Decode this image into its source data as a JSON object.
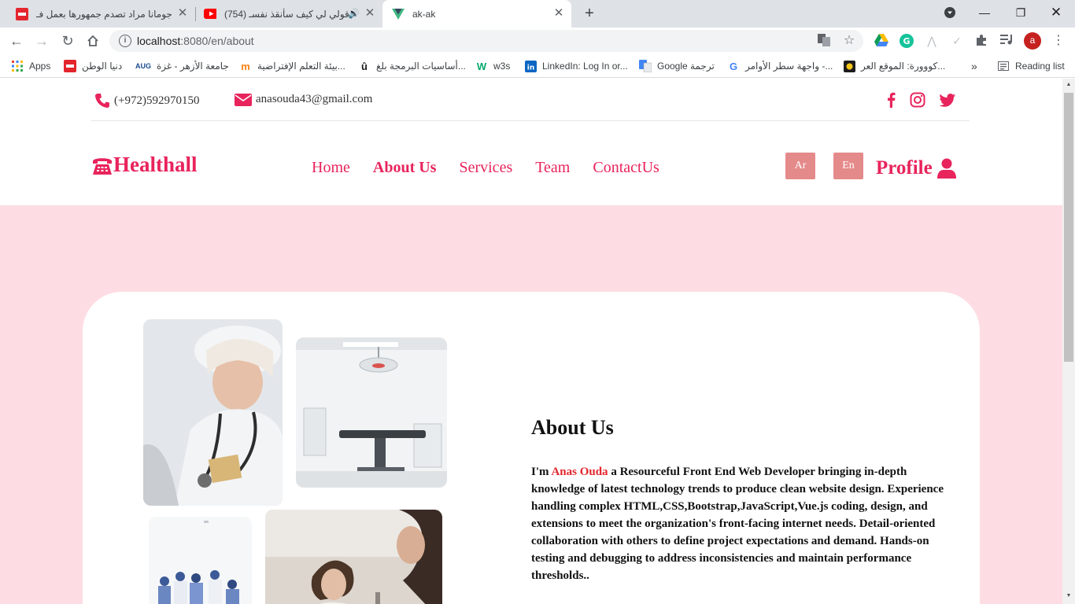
{
  "browser": {
    "tabs": [
      {
        "title": "جومانا مراد تصدم جمهورها بعمل فـ",
        "active": false
      },
      {
        "title": "(754) قولي لي كيف سأنقذ نفسـ",
        "active": false
      },
      {
        "title": "ak-ak",
        "active": true
      }
    ],
    "url_host": "localhost",
    "url_rest": ":8080/en/about",
    "avatar_letter": "a",
    "bookmarks": [
      {
        "label": "Apps",
        "icon": "apps-grid-icon"
      },
      {
        "label": "دنيا الوطن",
        "icon": "dunya-alwatan-icon"
      },
      {
        "label": "جامعة الأزهر - غزة",
        "icon": "azhar-icon",
        "icon_text": "AUG"
      },
      {
        "label": "بيئة التعلم الإفتراضية...",
        "icon": "moodle-icon"
      },
      {
        "label": "أساسيات البرمجة بلغ...",
        "icon": "udemy-icon"
      },
      {
        "label": "w3s",
        "icon": "w3schools-icon"
      },
      {
        "label": "LinkedIn: Log In or...",
        "icon": "linkedin-icon"
      },
      {
        "label": "Google ترجمة",
        "icon": "google-translate-icon"
      },
      {
        "label": "واجهة سطر الأوامر -...",
        "icon": "google-icon"
      },
      {
        "label": "كووورة: الموقع العر...",
        "icon": "kooora-icon"
      }
    ],
    "reading_list": "Reading list"
  },
  "site": {
    "phone": "(+972)592970150",
    "email": "anasouda43@gmail.com",
    "logo": "Healthall",
    "nav": [
      {
        "label": "Home",
        "active": false
      },
      {
        "label": "About Us",
        "active": true
      },
      {
        "label": "Services",
        "active": false
      },
      {
        "label": "Team",
        "active": false
      },
      {
        "label": "ContactUs",
        "active": false
      }
    ],
    "lang_ar": "Ar",
    "lang_en": "En",
    "profile": "Profile",
    "about": {
      "heading": "About Us",
      "intro": "I'm ",
      "name": "Anas Ouda",
      "body": " a Resourceful Front End Web Developer bringing in-depth knowledge of latest technology trends to produce clean website design. Experience handling complex HTML,CSS,Bootstrap,JavaScript,Vue.js coding, design, and extensions to meet the organization's front-facing internet needs. Detail-oriented collaboration with others to define project expectations and demand. Hands-on testing and debugging to address inconsistencies and maintain performance thresholds.."
    }
  },
  "colors": {
    "brand": "#e8245c",
    "hero_bg": "#fddde3",
    "lang_button": "#e58a8a",
    "name_highlight": "#e3262d"
  }
}
